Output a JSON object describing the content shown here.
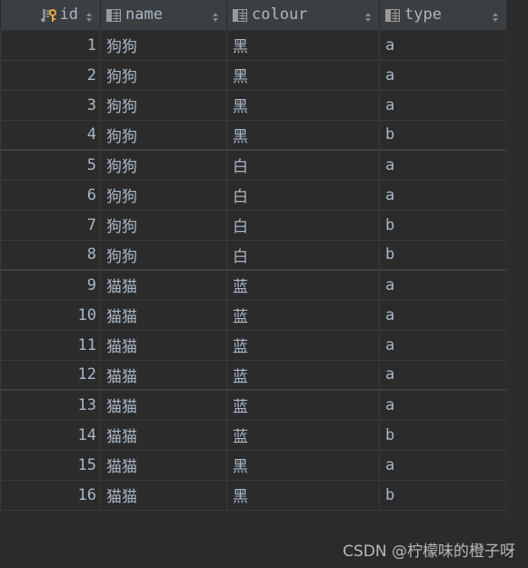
{
  "table": {
    "columns": [
      {
        "key": "id",
        "label": "id",
        "icon": "primary-key-column-icon"
      },
      {
        "key": "name",
        "label": "name",
        "icon": "table-column-icon"
      },
      {
        "key": "colour",
        "label": "colour",
        "icon": "table-column-icon"
      },
      {
        "key": "type",
        "label": "type",
        "icon": "table-column-icon"
      }
    ],
    "rows": [
      {
        "id": "1",
        "name": "狗狗",
        "colour": "黑",
        "type": "a"
      },
      {
        "id": "2",
        "name": "狗狗",
        "colour": "黑",
        "type": "a"
      },
      {
        "id": "3",
        "name": "狗狗",
        "colour": "黑",
        "type": "a"
      },
      {
        "id": "4",
        "name": "狗狗",
        "colour": "黑",
        "type": "b"
      },
      {
        "id": "5",
        "name": "狗狗",
        "colour": "白",
        "type": "a"
      },
      {
        "id": "6",
        "name": "狗狗",
        "colour": "白",
        "type": "a"
      },
      {
        "id": "7",
        "name": "狗狗",
        "colour": "白",
        "type": "b"
      },
      {
        "id": "8",
        "name": "狗狗",
        "colour": "白",
        "type": "b"
      },
      {
        "id": "9",
        "name": "猫猫",
        "colour": "蓝",
        "type": "a"
      },
      {
        "id": "10",
        "name": "猫猫",
        "colour": "蓝",
        "type": "a"
      },
      {
        "id": "11",
        "name": "猫猫",
        "colour": "蓝",
        "type": "a"
      },
      {
        "id": "12",
        "name": "猫猫",
        "colour": "蓝",
        "type": "a"
      },
      {
        "id": "13",
        "name": "猫猫",
        "colour": "蓝",
        "type": "a"
      },
      {
        "id": "14",
        "name": "猫猫",
        "colour": "蓝",
        "type": "b"
      },
      {
        "id": "15",
        "name": "猫猫",
        "colour": "黑",
        "type": "a"
      },
      {
        "id": "16",
        "name": "猫猫",
        "colour": "黑",
        "type": "b"
      }
    ]
  },
  "watermark": "CSDN @柠檬味的橙子呀",
  "colors": {
    "background": "#2b2b2b",
    "header_background": "#3c3f41",
    "text": "#a9b7c6",
    "key_icon": "#e5a93a"
  }
}
